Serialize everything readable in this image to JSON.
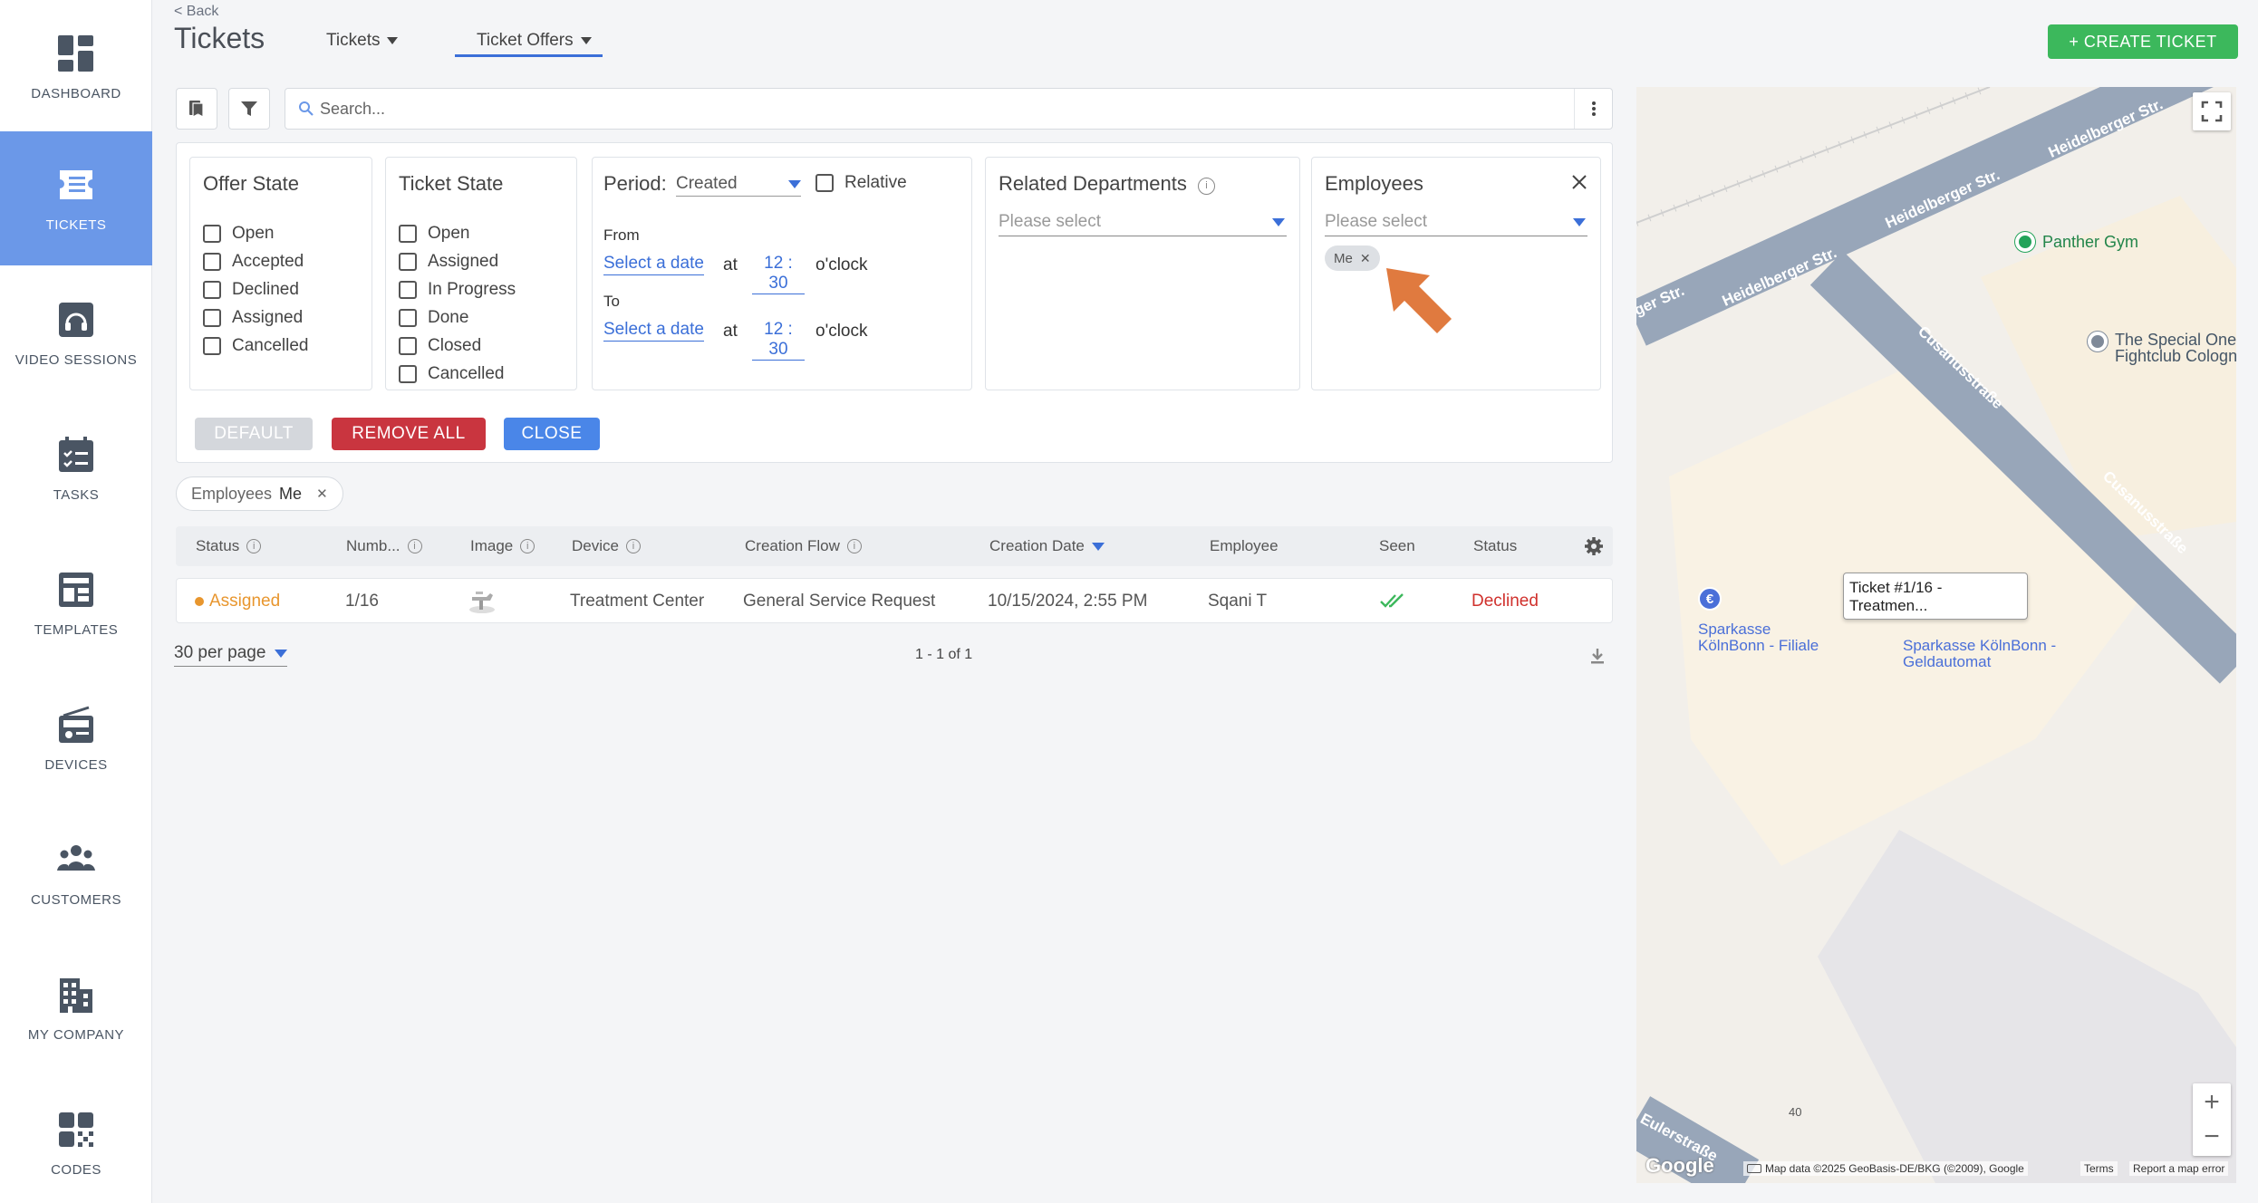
{
  "sidebar": {
    "items": [
      {
        "label": "DASHBOARD",
        "icon": "dashboard-icon"
      },
      {
        "label": "TICKETS",
        "icon": "tickets-icon",
        "active": true
      },
      {
        "label": "VIDEO SESSIONS",
        "icon": "video-sessions-icon"
      },
      {
        "label": "TASKS",
        "icon": "tasks-icon"
      },
      {
        "label": "TEMPLATES",
        "icon": "templates-icon"
      },
      {
        "label": "DEVICES",
        "icon": "devices-icon"
      },
      {
        "label": "CUSTOMERS",
        "icon": "customers-icon"
      },
      {
        "label": "MY COMPANY",
        "icon": "company-icon"
      },
      {
        "label": "CODES",
        "icon": "codes-icon"
      }
    ]
  },
  "header": {
    "back": "< Back",
    "title": "Tickets",
    "tabs": [
      {
        "label": "Tickets"
      },
      {
        "label": "Ticket Offers",
        "active": true
      }
    ],
    "create_label": "+ CREATE TICKET"
  },
  "search": {
    "placeholder": "Search..."
  },
  "filters": {
    "offer_state": {
      "title": "Offer State",
      "options": [
        "Open",
        "Accepted",
        "Declined",
        "Assigned",
        "Cancelled"
      ]
    },
    "ticket_state": {
      "title": "Ticket State",
      "options": [
        "Open",
        "Assigned",
        "In Progress",
        "Done",
        "Closed",
        "Cancelled"
      ]
    },
    "period": {
      "title": "Period:",
      "selected": "Created",
      "relative_label": "Relative",
      "from_label": "From",
      "to_label": "To",
      "select_date": "Select a date",
      "at": "at",
      "time_from": "12 : 30",
      "time_to": "12 : 30",
      "oclock": "o'clock"
    },
    "departments": {
      "title": "Related Departments",
      "placeholder": "Please select"
    },
    "employees": {
      "title": "Employees",
      "placeholder": "Please select",
      "chip": "Me"
    },
    "buttons": {
      "default": "DEFAULT",
      "remove_all": "REMOVE ALL",
      "close": "CLOSE"
    }
  },
  "active_filter": {
    "key": "Employees",
    "value": "Me"
  },
  "table": {
    "columns": [
      "Status",
      "Numb...",
      "Image",
      "Device",
      "Creation Flow",
      "Creation Date",
      "Employee",
      "Seen",
      "Status"
    ],
    "rows": [
      {
        "status": "Assigned",
        "number": "1/16",
        "device": "Treatment Center",
        "creation_flow": "General Service Request",
        "creation_date": "10/15/2024, 2:55 PM",
        "employee": "Sqani T",
        "offer_status": "Declined"
      }
    ]
  },
  "pagination": {
    "per_page": "30 per page",
    "range": "1 - 1 of 1"
  },
  "map": {
    "streets": [
      "Heidelberger Str.",
      "Heidelberger Str.",
      "Heidelberger Str.",
      "Heidelberger Str.",
      "ger Str.",
      "Cusanusstraße",
      "Cusanusstraße",
      "Eulerstraße"
    ],
    "pois": [
      "Panther Gym",
      "The Special One Fightclub Cologn",
      "Sparkasse KölnBonn - Filiale",
      "Sparkasse KölnBonn - Geldautomat"
    ],
    "tooltip": "Ticket #1/16 - Treatmen...",
    "house_number": "40",
    "attribution": "Map data ©2025 GeoBasis-DE/BKG (©2009), Google",
    "terms": "Terms",
    "report": "Report a map error",
    "logo": "Google"
  },
  "colors": {
    "accent": "#3b6fd8",
    "sidebar_active": "#6b98e8",
    "create": "#3cb85c",
    "remove_all": "#c9353f",
    "close": "#4a86e8",
    "declined": "#d0312d",
    "assigned": "#e8962e",
    "annotation_arrow": "#e07a3f"
  }
}
